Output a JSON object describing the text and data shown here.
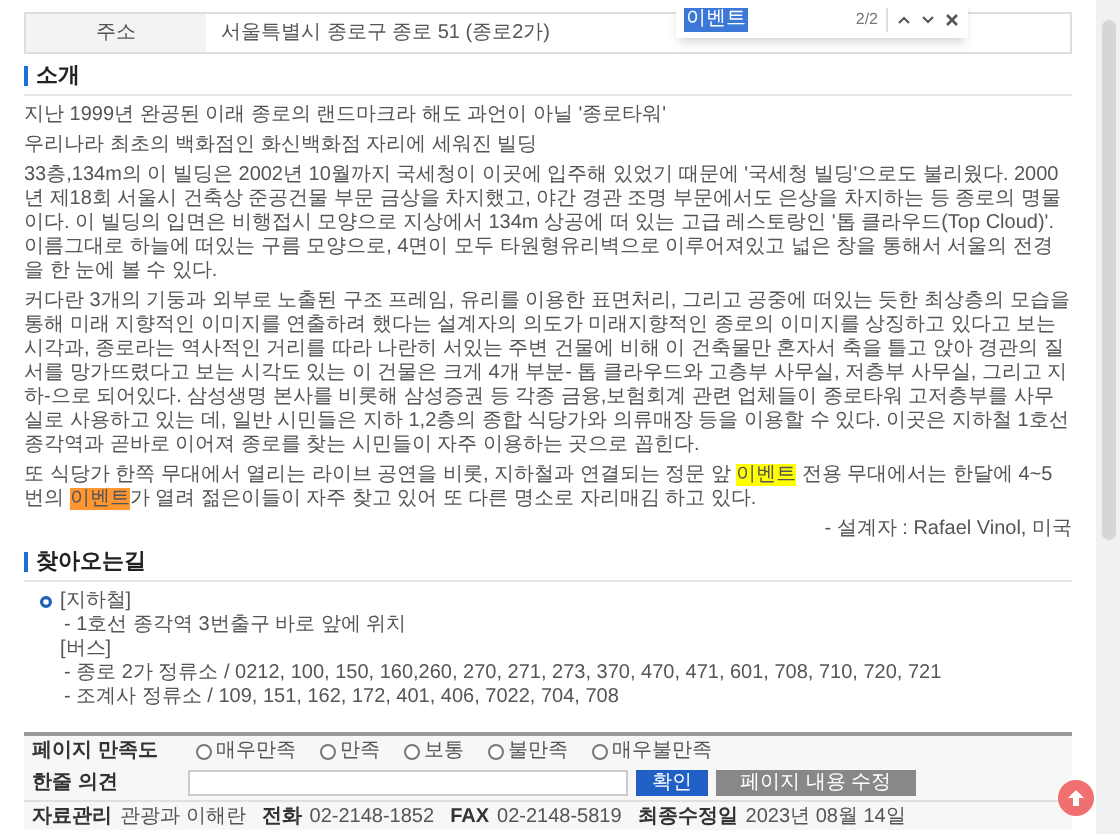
{
  "find_bar": {
    "value": "이벤트",
    "count": "2/2"
  },
  "info_table": {
    "rows": [
      {
        "label": "주소",
        "value": "서울특별시 종로구 종로 51 (종로2가)"
      }
    ]
  },
  "intro": {
    "title": "소개",
    "paragraphs": [
      {
        "parts": [
          {
            "text": "지난 1999년 완공된 이래 종로의 랜드마크라 해도 과언이 아닐 '종로타워'"
          }
        ]
      },
      {
        "parts": [
          {
            "text": "우리나라 최초의 백화점인 화신백화점 자리에 세워진 빌딩"
          }
        ]
      },
      {
        "parts": [
          {
            "text": "33층,134m의 이 빌딩은 2002년 10월까지 국세청이 이곳에 입주해 있었기 때문에 '국세청 빌딩'으로도 불리웠다. 2000년 제18회 서울시 건축상 준공건물 부문 금상을 차지했고, 야간 경관 조명 부문에서도 은상을 차지하는 등 종로의 명물이다. 이 빌딩의 입면은 비행접시 모양으로 지상에서 134m 상공에 떠 있는 고급 레스토랑인 '톱 클라우드(Top Cloud)'. 이름그대로 하늘에 떠있는 구름 모양으로, 4면이 모두 타원형유리벽으로 이루어져있고 넓은 창을 통해서 서울의 전경을 한 눈에 볼 수 있다."
          }
        ]
      },
      {
        "parts": [
          {
            "text": "커다란 3개의 기둥과 외부로 노출된 구조 프레임, 유리를 이용한 표면처리, 그리고 공중에 떠있는 듯한 최상층의 모습을 통해 미래 지향적인 이미지를 연출하려 했다는 설계자의 의도가 미래지향적인 종로의 이미지를 상징하고 있다고 보는 시각과, 종로라는 역사적인 거리를 따라 나란히 서있는 주변 건물에 비해 이 건축물만 혼자서 축을 틀고 앉아 경관의 질서를 망가뜨렸다고 보는 시각도 있는 이 건물은 크게 4개 부분- 톱 클라우드와 고층부 사무실, 저층부 사무실, 그리고 지하-으로 되어있다. 삼성생명 본사를 비롯해 삼성증권 등 각종 금융,보험회계 관련 업체들이 종로타워 고저층부를 사무실로 사용하고 있는 데, 일반 시민들은 지하 1,2층의 종합 식당가와 의류매장 등을 이용할 수 있다. 이곳은 지하철 1호선 종각역과 곧바로 이어져 종로를 찾는 시민들이 자주 이용하는 곳으로 꼽힌다."
          }
        ]
      },
      {
        "parts": [
          {
            "text": "또 식당가 한쪽 무대에서 열리는 라이브 공연을 비롯, 지하철과 연결되는 정문 앞 "
          },
          {
            "text": "이벤트",
            "match": true,
            "current": false
          },
          {
            "text": " 전용 무대에서는 한달에 4~5번의 "
          },
          {
            "text": "이벤트",
            "match": true,
            "current": true
          },
          {
            "text": "가 열려 젊은이들이 자주 찾고 있어 또 다른 명소로 자리매김 하고 있다."
          }
        ]
      }
    ],
    "credit": "- 설계자 : Rafael Vinol, 미국"
  },
  "directions": {
    "title": "찾아오는길",
    "groups": [
      {
        "label": "[지하철]",
        "kind": "bulleted",
        "lines": [
          "- 1호선 종각역 3번출구 바로 앞에 위치"
        ]
      },
      {
        "label": "[버스]",
        "kind": "plain",
        "lines": [
          "- 종로 2가 정류소 / 0212, 100, 150, 160,260, 270, 271, 273, 370, 470, 471, 601, 708, 710, 720, 721",
          "- 조계사 정류소 / 109, 151, 162, 172, 401, 406, 7022, 704, 708"
        ]
      }
    ]
  },
  "feedback": {
    "label": "페이지 만족도",
    "options": [
      {
        "label": "매우만족",
        "selected": false
      },
      {
        "label": "만족",
        "selected": false
      },
      {
        "label": "보통",
        "selected": false
      },
      {
        "label": "불만족",
        "selected": false
      },
      {
        "label": "매우불만족",
        "selected": false
      }
    ],
    "comment_label": "한줄 의견",
    "buttons": [
      {
        "label": "확인",
        "kind": "primary"
      },
      {
        "label": "페이지 내용 수정",
        "kind": "secondary"
      }
    ]
  },
  "info_bar": [
    {
      "label": "자료관리",
      "value": "관광과 이해란"
    },
    {
      "label": "전화",
      "value": "02-2148-1852"
    },
    {
      "label": "FAX",
      "value": "02-2148-5819"
    },
    {
      "label": "최종수정일",
      "value": "2023년 08월 14일"
    }
  ]
}
